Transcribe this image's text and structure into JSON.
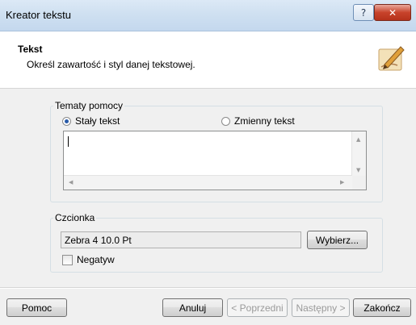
{
  "window": {
    "title": "Kreator tekstu",
    "help_label": "?",
    "close_label": "✕"
  },
  "header": {
    "title": "Tekst",
    "subtitle": "Określ zawartość i styl danej tekstowej."
  },
  "help_topics": {
    "label": "Tematy pomocy",
    "option_static": "Stały tekst",
    "option_variable": "Zmienny tekst",
    "selected": "Stały tekst",
    "text_value": ""
  },
  "font": {
    "label": "Czcionka",
    "value": "Zebra 4 10.0 Pt",
    "choose_label": "Wybierz...",
    "negative_label": "Negatyw",
    "negative_checked": false
  },
  "footer": {
    "help_label": "Pomoc",
    "cancel_label": "Anuluj",
    "prev_label": "< Poprzedni",
    "next_label": "Następny >",
    "finish_label": "Zakończ"
  }
}
